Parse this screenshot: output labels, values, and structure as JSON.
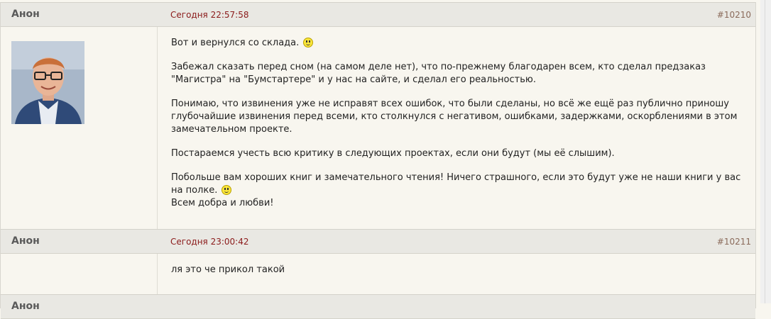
{
  "posts": [
    {
      "author": "Анон",
      "date": "Сегодня 22:57:58",
      "number": "#10210",
      "has_avatar": true,
      "paragraphs": [
        "Вот и вернулся со склада.",
        "Забежал сказать перед сном (на самом деле нет), что по-прежнему благодарен всем, кто сделал предзаказ \"Магистра\" на \"Бумстартере\" и у нас на сайте, и сделал его реальностью.",
        "Понимаю, что извинения уже не исправят всех ошибок, что были сделаны, но всё же ещё раз публично приношу глубочайшие извинения перед всеми, кто столкнулся с негативом, ошибками, задержками, оскорблениями в этом замечательном проекте.",
        "Постараемся учесть всю критику в следующих проектах, если они будут (мы её слышим).",
        "Побольше вам хороших книг и замечательного чтения! Ничего страшного, если это будут уже не наши книги у вас на полке.",
        "Всем добра и любви!"
      ],
      "smiley_icon": "smiley-icon"
    },
    {
      "author": "Анон",
      "date": "Сегодня 23:00:42",
      "number": "#10211",
      "has_avatar": false,
      "paragraphs": [
        "ля это че прикол такой"
      ]
    },
    {
      "author": "Анон"
    }
  ],
  "colors": {
    "background": "#f8f6ef",
    "header": "#e9e8e3",
    "date": "#8b1a1a",
    "post_number": "#8a6a5a",
    "author": "#5a5a5a"
  }
}
